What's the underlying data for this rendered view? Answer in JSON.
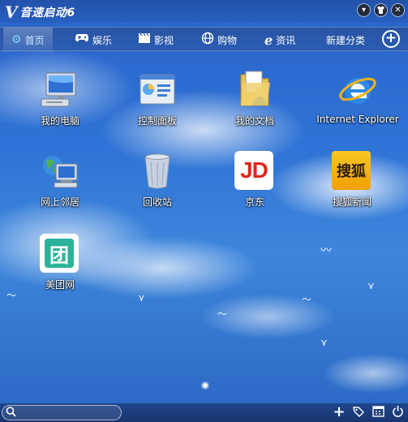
{
  "app": {
    "logo_letter": "V",
    "title": "音速启动6"
  },
  "window_buttons": [
    {
      "icon": "dropdown-icon",
      "glyph": "▾"
    },
    {
      "icon": "skin-icon",
      "glyph": "👕"
    },
    {
      "icon": "close-icon",
      "glyph": "✕"
    }
  ],
  "tabs": [
    {
      "label": "首页",
      "icon": "gear-icon",
      "glyph": "⚙"
    },
    {
      "label": "娱乐",
      "icon": "gamepad-icon",
      "glyph": "🎮"
    },
    {
      "label": "影视",
      "icon": "film-icon",
      "glyph": "🎬"
    },
    {
      "label": "购物",
      "icon": "globe-icon",
      "glyph": "🌐"
    },
    {
      "label": "资讯",
      "icon": "ie-icon",
      "glyph": "ℯ"
    },
    {
      "label": "新建分类"
    }
  ],
  "apps": [
    {
      "label": "我的电脑",
      "icon": "computer-icon"
    },
    {
      "label": "控制面板",
      "icon": "control-panel-icon"
    },
    {
      "label": "我的文档",
      "icon": "documents-folder-icon"
    },
    {
      "label": "Internet Explorer",
      "icon": "internet-explorer-icon"
    },
    {
      "label": "网上邻居",
      "icon": "network-neighborhood-icon"
    },
    {
      "label": "回收站",
      "icon": "recycle-bin-icon"
    },
    {
      "label": "京东",
      "icon": "jd-icon",
      "tile_text": "JD"
    },
    {
      "label": "搜狐新闻",
      "icon": "sohu-news-icon",
      "tile_text": "搜狐"
    },
    {
      "label": "美团网",
      "icon": "meituan-icon",
      "tile_text": "团"
    }
  ],
  "colors": {
    "jd_red": "#e1251b",
    "sohu_yellow": "#f5b800",
    "meituan_teal": "#2bb39a"
  },
  "search": {
    "value": "",
    "placeholder": ""
  },
  "bottom_tools": [
    {
      "icon": "add-icon",
      "glyph": "+"
    },
    {
      "icon": "tag-icon",
      "glyph": "⌂"
    },
    {
      "icon": "calendar-icon",
      "glyph": "▦"
    },
    {
      "icon": "power-icon",
      "glyph": "⏻"
    }
  ]
}
